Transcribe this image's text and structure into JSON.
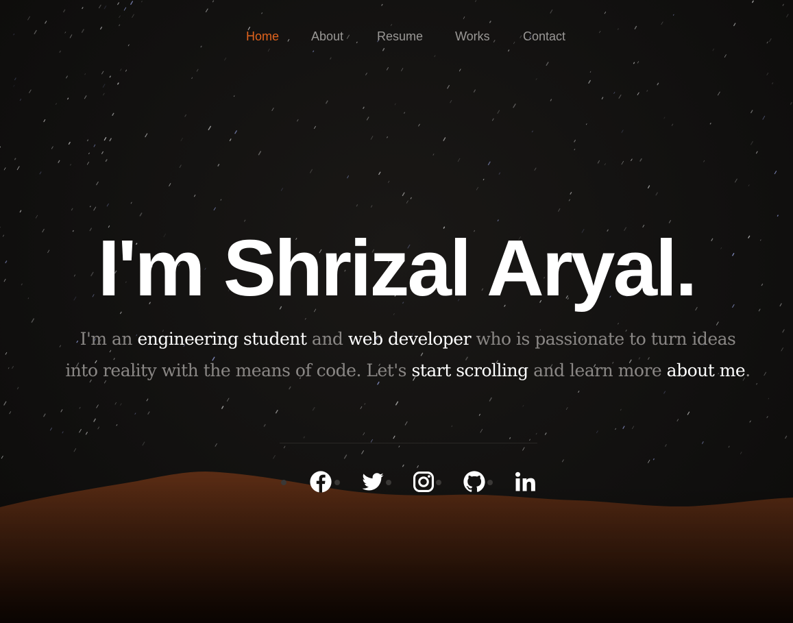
{
  "nav": {
    "items": [
      {
        "label": "Home",
        "active": true
      },
      {
        "label": "About",
        "active": false
      },
      {
        "label": "Resume",
        "active": false
      },
      {
        "label": "Works",
        "active": false
      },
      {
        "label": "Contact",
        "active": false
      }
    ]
  },
  "hero": {
    "headline": "I'm Shrizal Aryal.",
    "intro": {
      "part1": "I'm an ",
      "hl1": "engineering student",
      "part2": " and ",
      "hl2": "web developer",
      "part3": " who is passionate to turn ideas into reality with the means of code. Let's ",
      "hl3": "start scrolling",
      "part4": " and learn more ",
      "hl4": "about me",
      "part5": "."
    }
  },
  "social": {
    "links": [
      {
        "name": "facebook-icon"
      },
      {
        "name": "twitter-icon"
      },
      {
        "name": "instagram-icon"
      },
      {
        "name": "github-icon"
      },
      {
        "name": "linkedin-icon"
      }
    ]
  },
  "colors": {
    "accent": "#e0631d",
    "text_muted": "#8a8785",
    "text_highlight": "#ffffff",
    "nav_text": "#9a9896",
    "dune": "#4a2411"
  }
}
